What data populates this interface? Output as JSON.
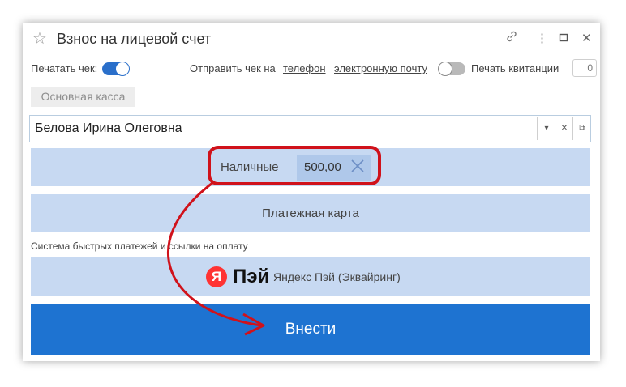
{
  "window": {
    "title": "Взнос на лицевой счет"
  },
  "options": {
    "print_check_label": "Печатать чек:",
    "print_check_on": true,
    "send_check_label": "Отправить чек на",
    "send_phone_link": "телефон",
    "send_email_link": "электронную почту",
    "print_receipt_on": false,
    "print_receipt_label": "Печать квитанции",
    "receipt_count": "0"
  },
  "cashbox": {
    "label": "Основная касса"
  },
  "payer": {
    "value": "Белова Ирина Олеговна"
  },
  "payments": {
    "cash_label": "Наличные",
    "cash_amount": "500,00",
    "card_label": "Платежная карта",
    "sbp_section_label": "Система быстрых платежей и ссылки на оплату",
    "yandex_logo_letter": "Я",
    "yandex_logo_word": "Пэй",
    "yandex_label": "Яндекс Пэй (Эквайринг)"
  },
  "submit": {
    "label": "Внести"
  },
  "colors": {
    "accent": "#1e73d1",
    "button_bg": "#c7d9f2",
    "annotation": "#d0121b",
    "yandex_red": "#ff3333"
  }
}
